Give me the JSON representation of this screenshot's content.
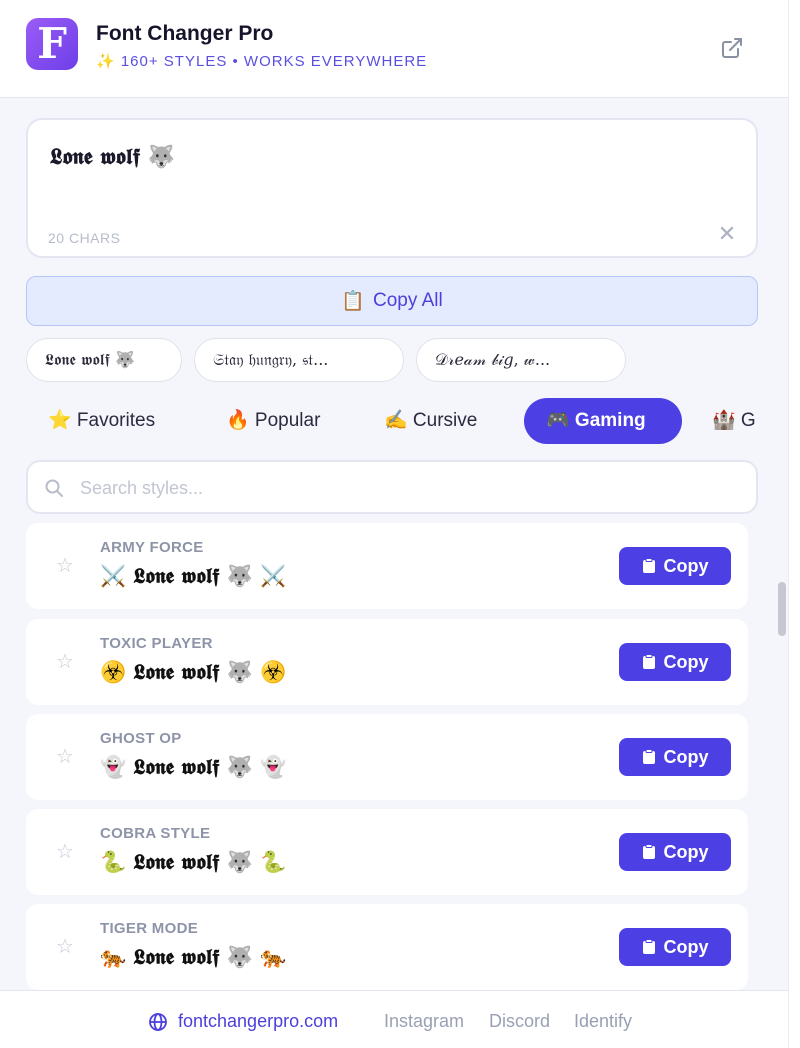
{
  "header": {
    "logo_letter": "F",
    "title": "Font Changer Pro",
    "subtitle": "✨ 160+ STYLES • WORKS EVERYWHERE",
    "external_icon": "external-link-icon"
  },
  "input": {
    "text": "𝕷𝖔𝖓𝖊 𝖜𝖔𝖑𝖋 🐺",
    "char_count": "20 CHARS",
    "clear_label": "✕"
  },
  "copy_all": {
    "icon": "📋",
    "label": "Copy All"
  },
  "chips": [
    {
      "label": "𝕷𝖔𝖓𝖊 𝖜𝖔𝖑𝖋 🐺"
    },
    {
      "label": "𝔖𝔱𝔞𝔶 𝔥𝔲𝔫𝔤𝔯𝔶, 𝔰𝔱..."
    },
    {
      "label": "𝒟𝓇𝑒𝒶𝓂 𝒷𝒾𝑔, 𝓌..."
    }
  ],
  "tabs": [
    {
      "label": "⭐ Favorites"
    },
    {
      "label": "🔥 Popular"
    },
    {
      "label": "✍️ Cursive"
    },
    {
      "label": "🎮 Gaming"
    },
    {
      "label": "🏰 G"
    }
  ],
  "search": {
    "placeholder": "Search styles..."
  },
  "styles": [
    {
      "name": "ARMY FORCE",
      "preview": "⚔️ 𝕷𝖔𝖓𝖊 𝖜𝖔𝖑𝖋 🐺 ⚔️",
      "copy_label": "Copy"
    },
    {
      "name": "TOXIC PLAYER",
      "preview": "☣️ 𝕷𝖔𝖓𝖊 𝖜𝖔𝖑𝖋 🐺 ☣️",
      "copy_label": "Copy"
    },
    {
      "name": "GHOST OP",
      "preview": "👻 𝕷𝖔𝖓𝖊 𝖜𝖔𝖑𝖋 🐺 👻",
      "copy_label": "Copy"
    },
    {
      "name": "COBRA STYLE",
      "preview": "🐍 𝕷𝖔𝖓𝖊 𝖜𝖔𝖑𝖋 🐺 🐍",
      "copy_label": "Copy"
    },
    {
      "name": "TIGER MODE",
      "preview": "🐅 𝕷𝖔𝖓𝖊 𝖜𝖔𝖑𝖋 🐺 🐅",
      "copy_label": "Copy"
    }
  ],
  "footer": {
    "site": "fontchangerpro.com",
    "links": [
      "Instagram",
      "Discord",
      "Identify"
    ]
  },
  "colors": {
    "accent": "#4c3fe4",
    "logo_gradient_start": "#9b5cf6",
    "logo_gradient_end": "#6d3fe8",
    "copy_all_bg": "#e5ebff"
  }
}
